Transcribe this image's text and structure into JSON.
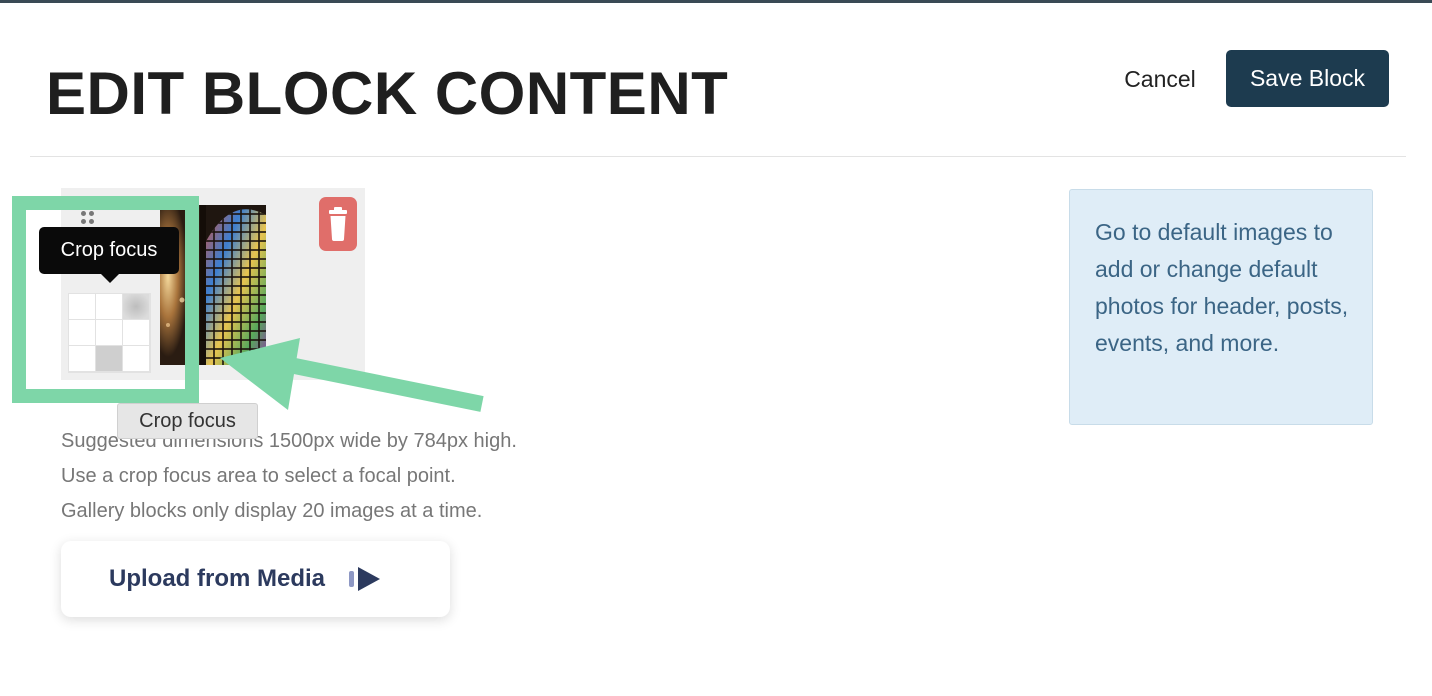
{
  "header": {
    "title": "EDIT BLOCK CONTENT",
    "cancel_label": "Cancel",
    "save_label": "Save Block"
  },
  "gallery": {
    "image_alt": "Stained glass window photo",
    "crop_grid": {
      "rows": 3,
      "cols": 3,
      "highlighted_cells": [
        "top-right",
        "bottom-center"
      ]
    },
    "tooltip_label": "Crop focus",
    "tooltip_hover_label": "Crop focus"
  },
  "help_lines": [
    "Suggested dimensions 1500px wide by 784px high.",
    "Use a crop focus area to select a focal point.",
    "Gallery blocks only display 20 images at a time."
  ],
  "upload": {
    "label": "Upload from Media",
    "icon": "media-play-icon"
  },
  "info_box": {
    "text": "Go to default images to add or change default photos for header, posts, events, and more."
  },
  "colors": {
    "save_button": "#1d3b4f",
    "delete_button": "#e06e6a",
    "annotation": "#7ed6a8",
    "info_bg": "#dfedf7",
    "info_text": "#3b6585",
    "upload_text": "#2c3a5e"
  },
  "icons": {
    "delete": "trash-icon",
    "drag": "drag-handle-icon",
    "upload": "media-play-icon"
  }
}
